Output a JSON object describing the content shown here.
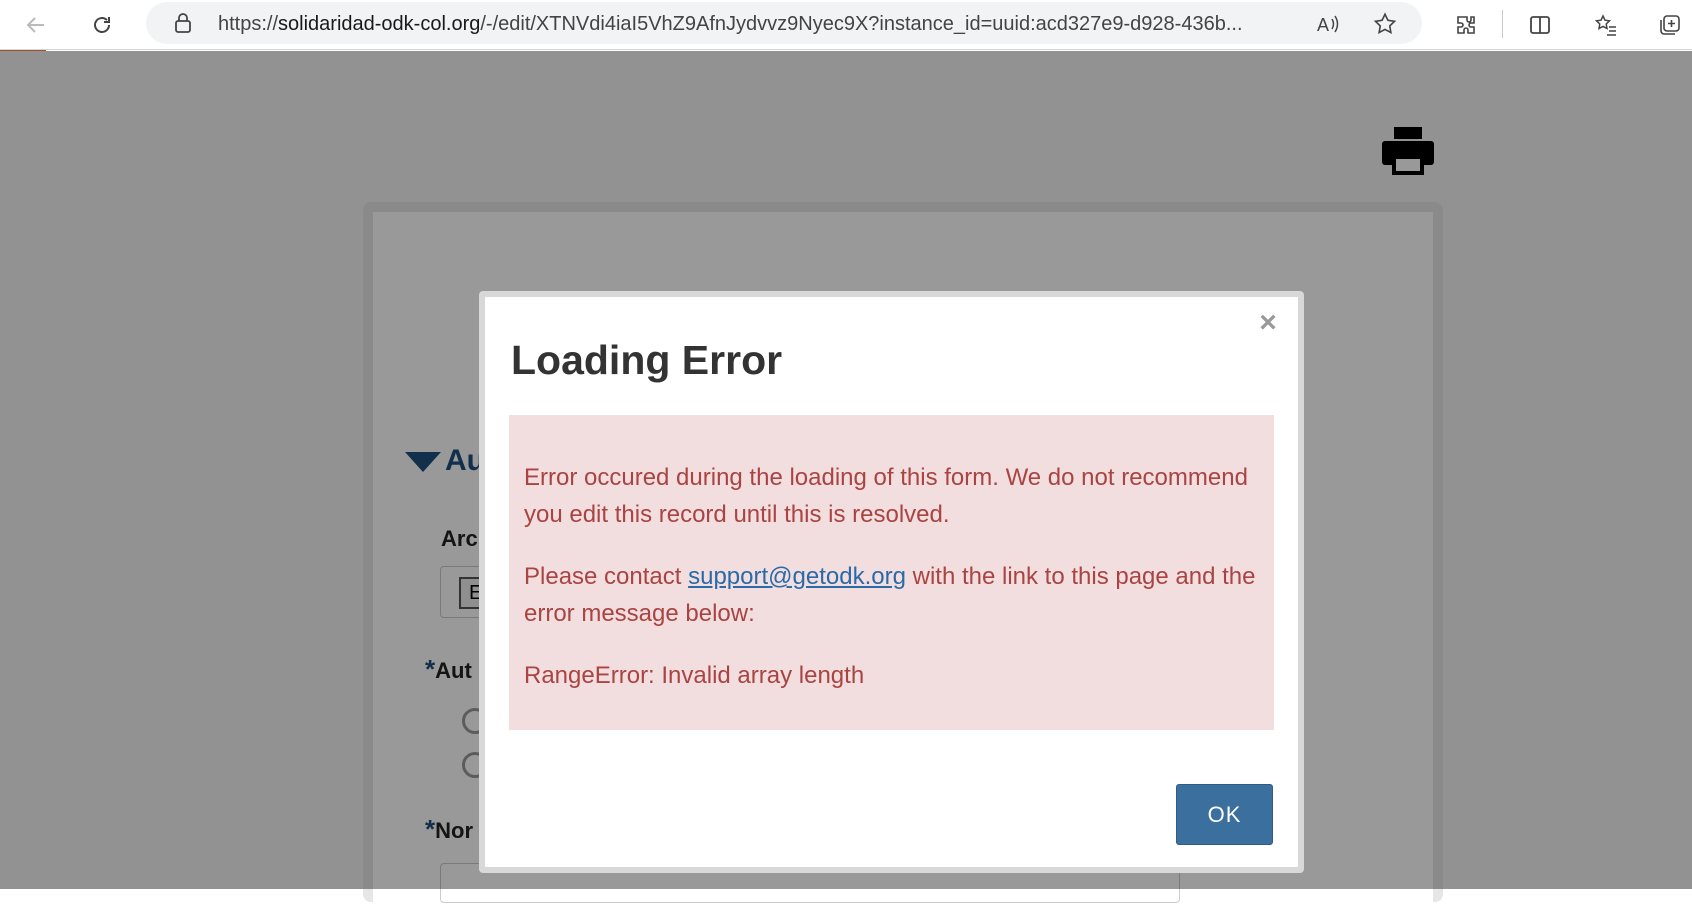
{
  "browser": {
    "url_prefix": "https://",
    "url_host": "solidaridad-odk-col.org",
    "url_path": "/-/edit/XTNVdi4iaI5VhZ9AfnJydvvz9Nyec9X?instance_id=uuid:acd327e9-d928-436b..."
  },
  "form": {
    "group_title": "Au",
    "q1_label": "Arc",
    "q1_button": "E",
    "q2_required": "*",
    "q2_label": "Aut",
    "q3_required": "*",
    "q3_label": "Nor"
  },
  "modal": {
    "title": "Loading Error",
    "close_symbol": "×",
    "message_1": "Error occured during the loading of this form. We do not recommend you edit this record until this is resolved.",
    "message_2_before": "Please contact ",
    "message_2_link": "support@getodk.org",
    "message_2_after": " with the link to this page and the error message below:",
    "error_detail": "RangeError: Invalid array length",
    "ok_label": "OK"
  },
  "colors": {
    "alert_bg": "#f2dedf",
    "alert_text": "#a94442",
    "primary_button": "#3a6f9e",
    "group_title": "#1e4f7f"
  }
}
